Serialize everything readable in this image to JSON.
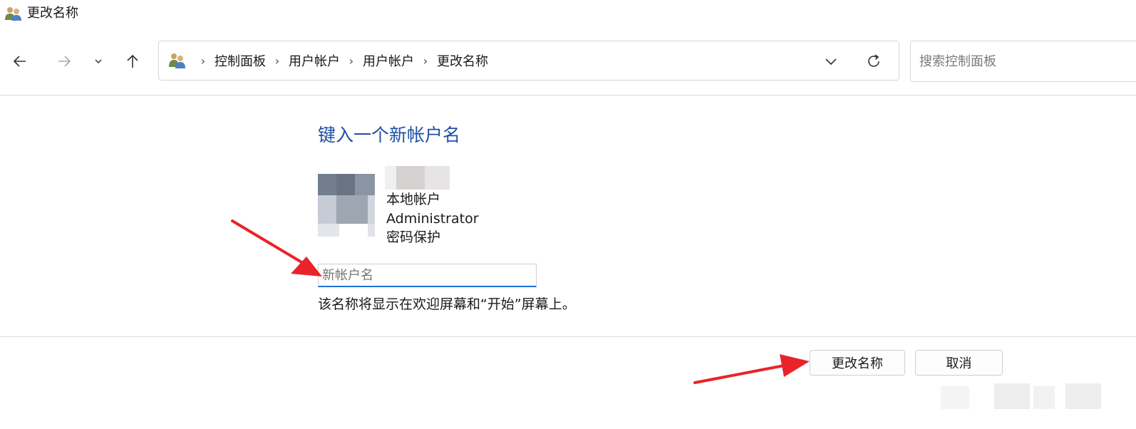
{
  "window": {
    "title": "更改名称",
    "icon": "users-icon"
  },
  "nav": {
    "back_icon": "arrow-left-icon",
    "forward_icon": "arrow-right-icon",
    "recent_icon": "chevron-down-icon",
    "up_icon": "arrow-up-icon"
  },
  "address_bar": {
    "icon": "control-panel-users-icon",
    "breadcrumb": [
      "控制面板",
      "用户帐户",
      "用户帐户",
      "更改名称"
    ],
    "dropdown_icon": "chevron-down-icon",
    "refresh_icon": "refresh-icon"
  },
  "search": {
    "placeholder": "搜索控制面板"
  },
  "content": {
    "heading": "键入一个新帐户名",
    "account": {
      "type": "本地帐户",
      "role": "Administrator",
      "protection": "密码保护"
    },
    "new_name_input": {
      "placeholder": "新帐户名",
      "value": ""
    },
    "hint": "该名称将显示在欢迎屏幕和“开始”屏幕上。"
  },
  "buttons": {
    "rename": "更改名称",
    "cancel": "取消"
  },
  "colors": {
    "heading": "#1f4fa5",
    "input_focus": "#1f6fd1",
    "annotation_arrow": "#e8242a"
  }
}
